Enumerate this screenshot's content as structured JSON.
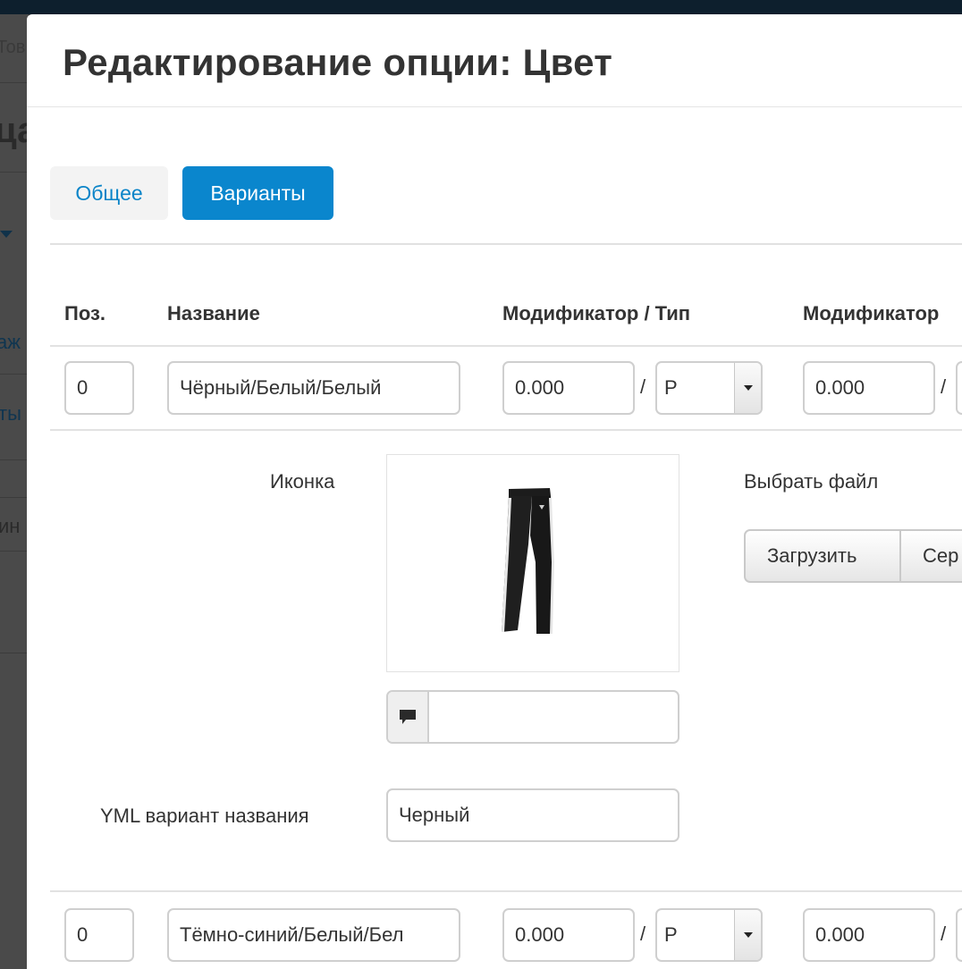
{
  "background": {
    "fragments": [
      "Тов",
      "ца",
      "аж",
      "ты",
      "ин"
    ]
  },
  "modal": {
    "title": "Редактирование опции: Цвет"
  },
  "tabs": [
    {
      "label": "Общее",
      "active": false
    },
    {
      "label": "Варианты",
      "active": true
    }
  ],
  "table": {
    "headers": [
      "Поз.",
      "Название",
      "Модификатор / Тип",
      "Модификатор"
    ],
    "rows": [
      {
        "position": "0",
        "name": "Чёрный/Белый/Белый",
        "modifier": "0.000",
        "type": "Р",
        "weight_modifier": "0.000",
        "separator": "/"
      },
      {
        "position": "0",
        "name": "Тёмно-синий/Белый/Бел",
        "modifier": "0.000",
        "type": "Р",
        "weight_modifier": "0.000",
        "separator": "/"
      }
    ]
  },
  "details": {
    "icon_label": "Иконка",
    "choose_file": "Выбрать файл",
    "upload_button": "Загрузить",
    "server_button": "Сер",
    "comment_value": "",
    "yml_label": "YML вариант названия",
    "yml_value": "Черный"
  },
  "colors": {
    "accent": "#0a86cd",
    "link": "#0a84c8"
  },
  "icons": {
    "comment": "comment-icon",
    "select_arrow": "caret-down-icon",
    "product": "pants-image"
  }
}
